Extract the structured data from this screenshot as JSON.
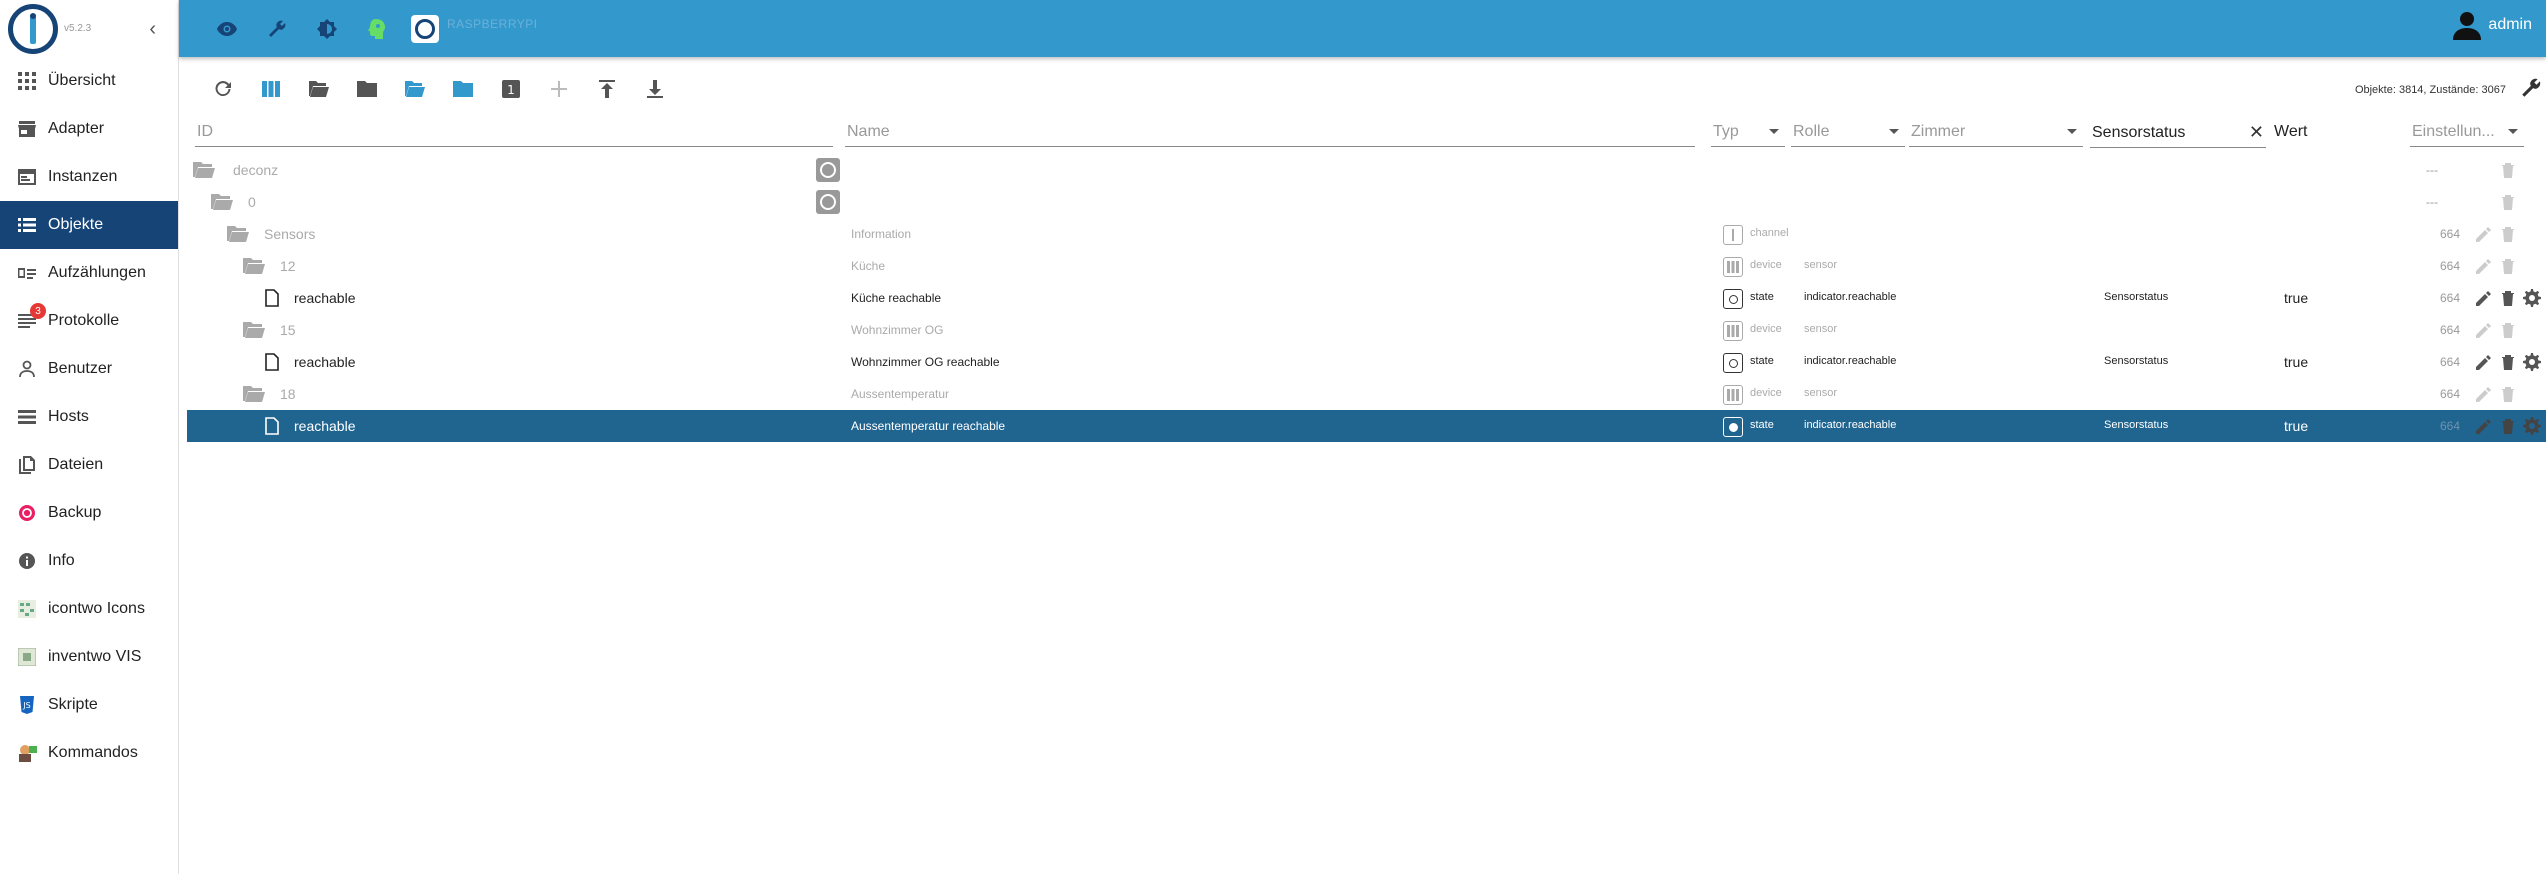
{
  "app": {
    "version": "v5.2.3",
    "host_name": "RASPBERRYPI",
    "user": "admin",
    "stats": "Objekte: 3814, Zustände: 3067"
  },
  "sidebar": {
    "items": [
      {
        "label": "Übersicht",
        "icon": "grid-icon"
      },
      {
        "label": "Adapter",
        "icon": "store-icon"
      },
      {
        "label": "Instanzen",
        "icon": "instances-icon"
      },
      {
        "label": "Objekte",
        "icon": "list-icon",
        "active": true
      },
      {
        "label": "Aufzählungen",
        "icon": "enums-icon"
      },
      {
        "label": "Protokolle",
        "icon": "log-icon",
        "badge": "3"
      },
      {
        "label": "Benutzer",
        "icon": "user-icon"
      },
      {
        "label": "Hosts",
        "icon": "hosts-icon"
      },
      {
        "label": "Dateien",
        "icon": "files-icon"
      },
      {
        "label": "Backup",
        "icon": "backup-icon"
      },
      {
        "label": "Info",
        "icon": "info-icon"
      },
      {
        "label": "icontwo Icons",
        "icon": "icontwo-icon"
      },
      {
        "label": "inventwo VIS",
        "icon": "inventwo-icon"
      },
      {
        "label": "Skripte",
        "icon": "scripts-icon"
      },
      {
        "label": "Kommandos",
        "icon": "commands-icon"
      }
    ]
  },
  "table": {
    "headers": {
      "id": "ID",
      "name": "Name",
      "type": "Typ",
      "role": "Rolle",
      "room": "Zimmer",
      "function_filter": "Sensorstatus",
      "value": "Wert",
      "settings": "Einstellun..."
    },
    "rows": [
      {
        "id": "deconz",
        "name": "",
        "type": "",
        "role": "",
        "func": "",
        "value": "",
        "acl": "---"
      },
      {
        "id": "0",
        "name": "",
        "type": "",
        "role": "",
        "func": "",
        "value": "",
        "acl": "---"
      },
      {
        "id": "Sensors",
        "name": "Information",
        "type": "channel",
        "role": "",
        "func": "",
        "value": "",
        "acl": "664"
      },
      {
        "id": "12",
        "name": "Küche",
        "type": "device",
        "role": "sensor",
        "func": "",
        "value": "",
        "acl": "664"
      },
      {
        "id": "reachable",
        "name": "Küche reachable",
        "type": "state",
        "role": "indicator.reachable",
        "func": "Sensorstatus",
        "value": "true",
        "acl": "664"
      },
      {
        "id": "15",
        "name": "Wohnzimmer OG",
        "type": "device",
        "role": "sensor",
        "func": "",
        "value": "",
        "acl": "664"
      },
      {
        "id": "reachable",
        "name": "Wohnzimmer OG reachable",
        "type": "state",
        "role": "indicator.reachable",
        "func": "Sensorstatus",
        "value": "true",
        "acl": "664"
      },
      {
        "id": "18",
        "name": "Aussentemperatur",
        "type": "device",
        "role": "sensor",
        "func": "",
        "value": "",
        "acl": "664"
      },
      {
        "id": "reachable",
        "name": "Aussentemperatur reachable",
        "type": "state",
        "role": "indicator.reachable",
        "func": "Sensorstatus",
        "value": "true",
        "acl": "664"
      }
    ]
  },
  "colors": {
    "topbar": "#3399cc",
    "active_nav": "#164477",
    "selected_row": "#206490"
  }
}
